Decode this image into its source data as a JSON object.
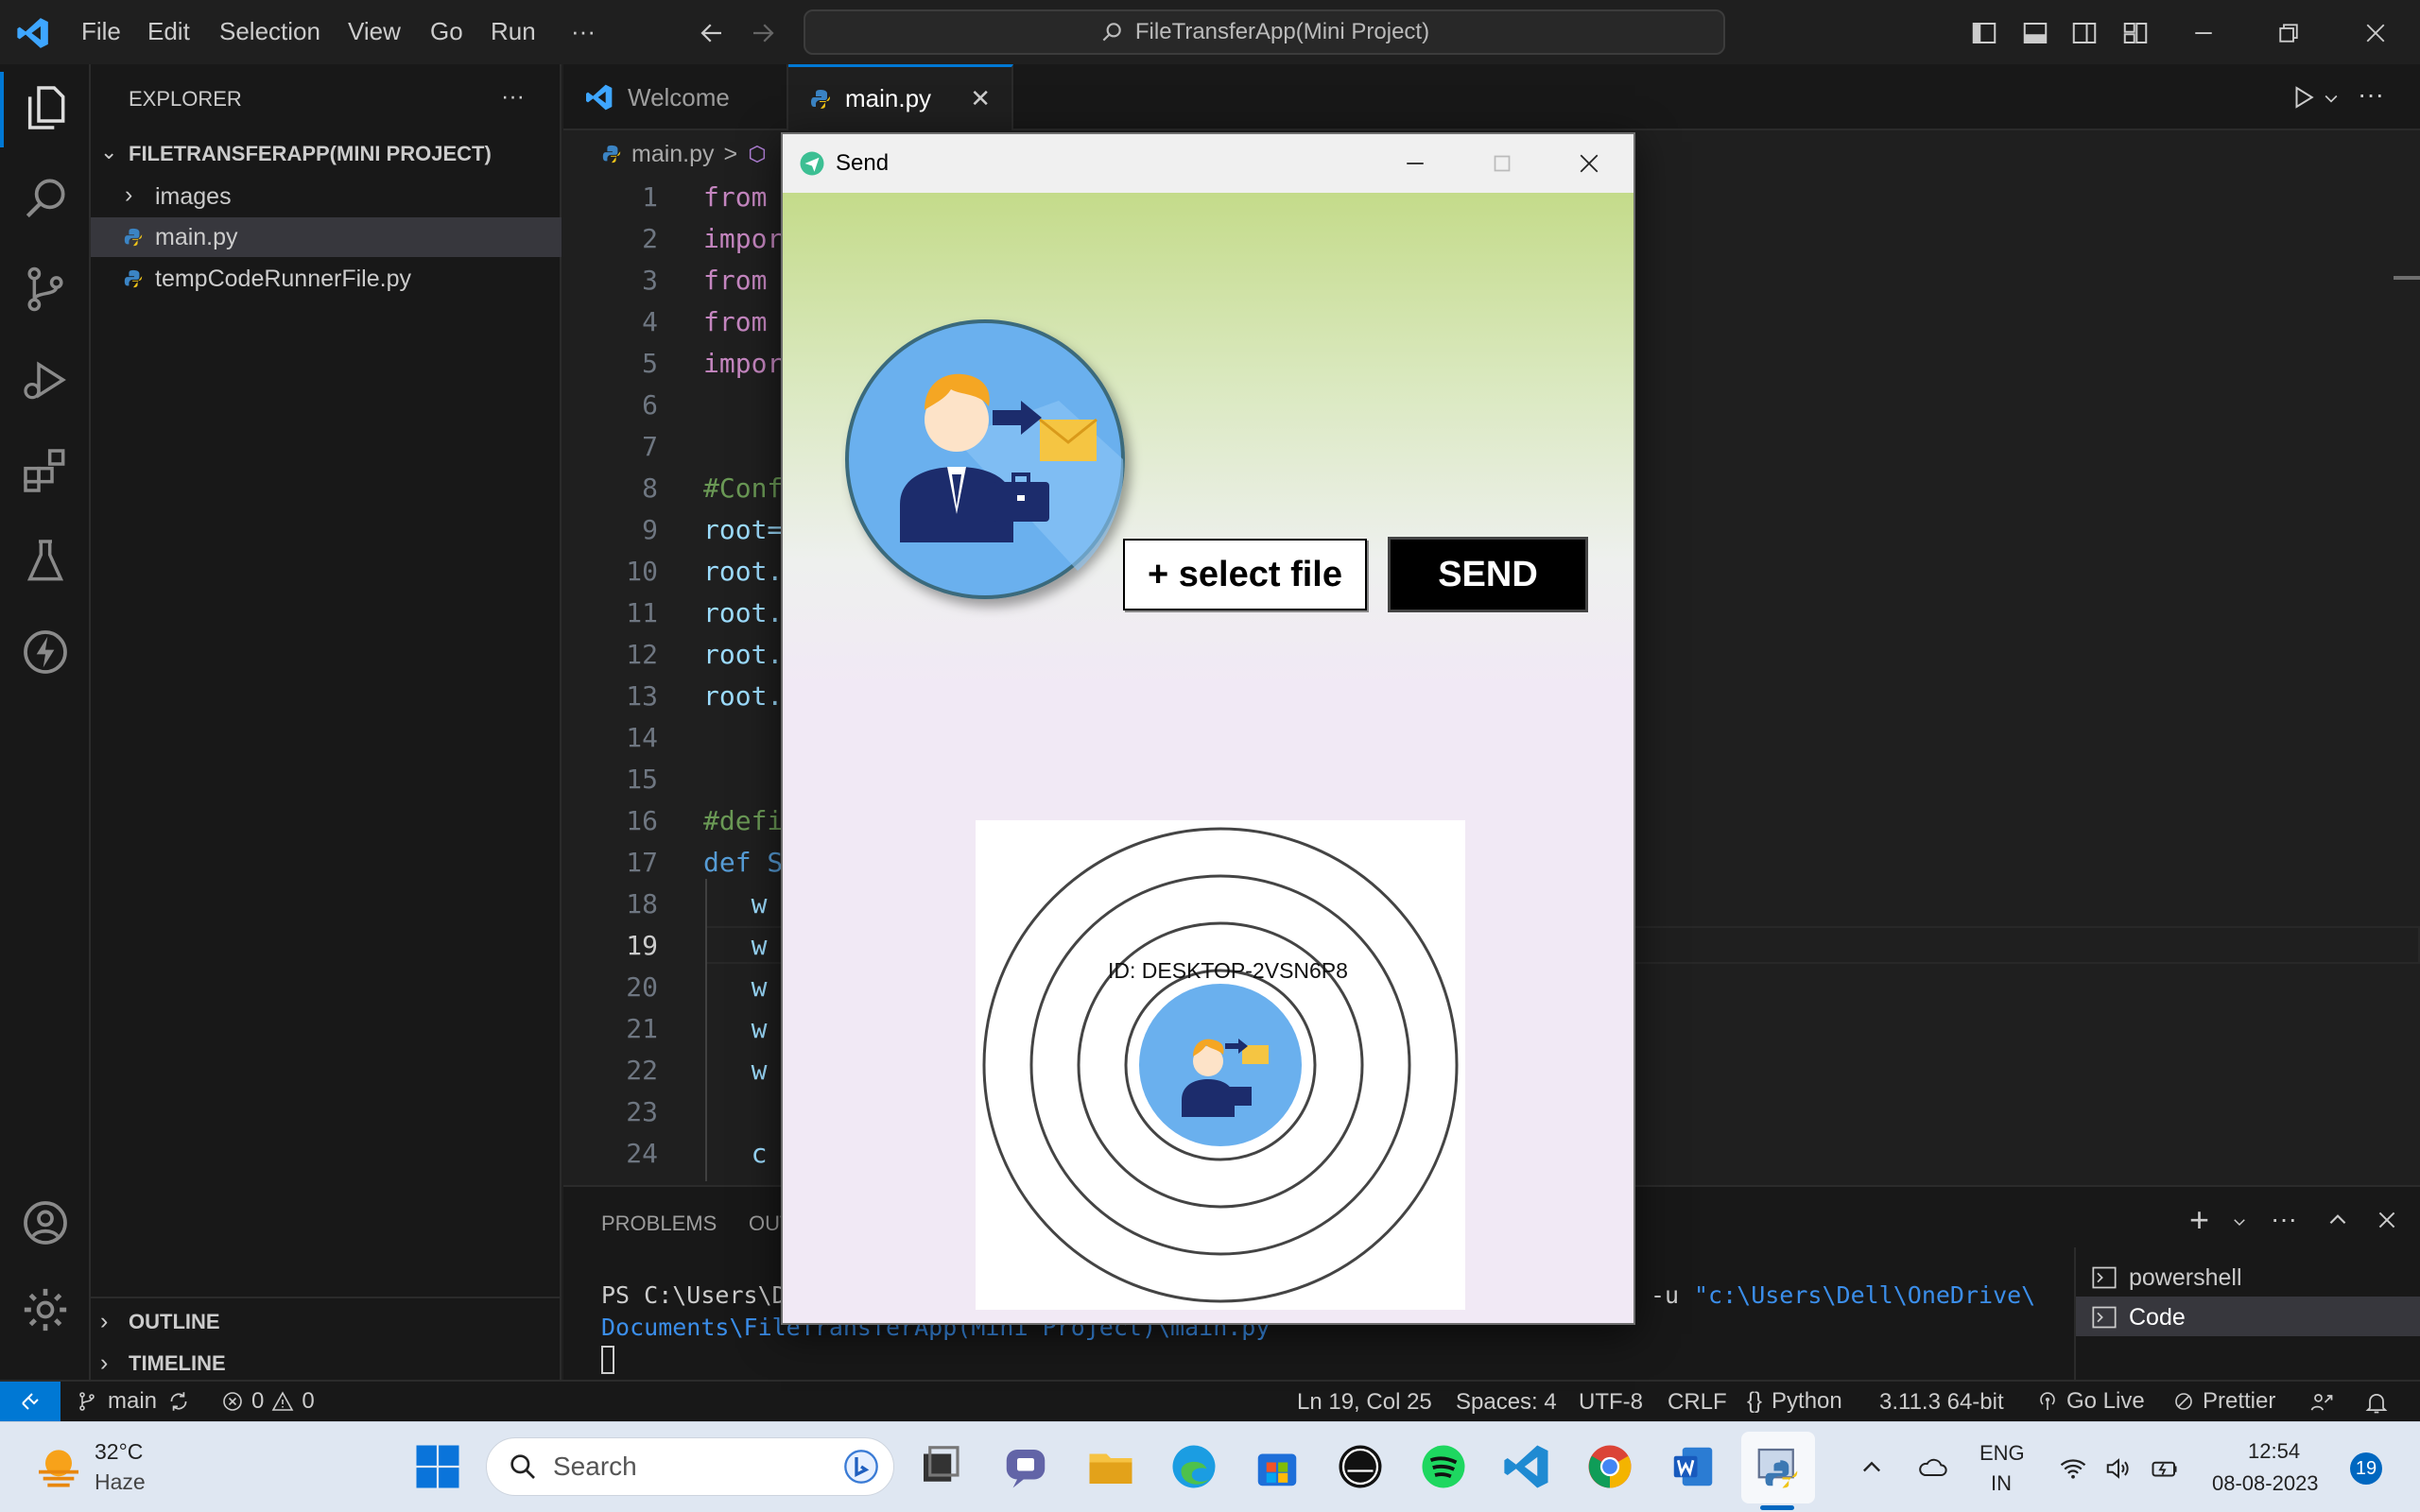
{
  "titlebar": {
    "menu": [
      "File",
      "Edit",
      "Selection",
      "View",
      "Go",
      "Run",
      "···"
    ],
    "search": "FileTransferApp(Mini Project)"
  },
  "sidebar": {
    "title": "EXPLORER",
    "more": "···",
    "project": "FILETRANSFERAPP(MINI PROJECT)",
    "items": [
      "images",
      "main.py",
      "tempCodeRunnerFile.py"
    ],
    "outline": "OUTLINE",
    "timeline": "TIMELINE"
  },
  "tabs": [
    {
      "label": "Welcome"
    },
    {
      "label": "main.py",
      "close": "✕"
    }
  ],
  "breadcrumb": {
    "file": "main.py",
    "sep": ">"
  },
  "code": {
    "line_numbers": [
      "1",
      "2",
      "3",
      "4",
      "5",
      "6",
      "7",
      "8",
      "9",
      "10",
      "11",
      "12",
      "13",
      "14",
      "15",
      "16",
      "17",
      "18",
      "19",
      "20",
      "21",
      "22",
      "23",
      "24"
    ],
    "lines": [
      {
        "text": "from",
        "color": "#c586c0"
      },
      {
        "text": "impor",
        "color": "#c586c0"
      },
      {
        "text": "from",
        "color": "#c586c0"
      },
      {
        "text": "from",
        "color": "#c586c0"
      },
      {
        "text": "impor",
        "color": "#c586c0"
      },
      {
        "text": "",
        "color": "#ccc"
      },
      {
        "text": "",
        "color": "#ccc"
      },
      {
        "text": "#Conf",
        "color": "#6a9955"
      },
      {
        "text": "root=",
        "color": "#9cdcfe"
      },
      {
        "text": "root.",
        "color": "#9cdcfe"
      },
      {
        "text": "root.",
        "color": "#9cdcfe"
      },
      {
        "text": "root.",
        "color": "#9cdcfe"
      },
      {
        "text": "root.",
        "color": "#9cdcfe"
      },
      {
        "text": "",
        "color": "#ccc"
      },
      {
        "text": "",
        "color": "#ccc"
      },
      {
        "text": "#defi",
        "color": "#6a9955"
      },
      {
        "text": "def S",
        "color": "#569cd6"
      },
      {
        "text": "   w",
        "color": "#9cdcfe"
      },
      {
        "text": "   w",
        "color": "#9cdcfe"
      },
      {
        "text": "   w",
        "color": "#9cdcfe"
      },
      {
        "text": "   w",
        "color": "#9cdcfe"
      },
      {
        "text": "   w",
        "color": "#9cdcfe"
      },
      {
        "text": "",
        "color": "#ccc"
      },
      {
        "text": "   c",
        "color": "#9cdcfe"
      }
    ]
  },
  "panel": {
    "tabs": [
      "PROBLEMS",
      "OUT"
    ],
    "terminal_line1_a": "PS C:\\Users\\D",
    "terminal_line1_b": "-u ",
    "terminal_line1_c": "\"c:\\Users\\Dell\\OneDrive\\",
    "terminal_line2": "Documents\\FileTransferApp(Mini Project)\\main.py",
    "terminals": [
      "powershell",
      "Code"
    ]
  },
  "statusbar": {
    "branch": "main",
    "errors": "0",
    "warnings": "0",
    "position": "Ln 19, Col 25",
    "spaces": "Spaces: 4",
    "encoding": "UTF-8",
    "eol": "CRLF",
    "language": "Python",
    "interpreter": "3.11.3 64-bit",
    "golive": "Go Live",
    "prettier": "Prettier"
  },
  "send_window": {
    "title": "Send",
    "select_label": "+ select file",
    "send_label": "SEND",
    "id_label": "ID: DESKTOP-2VSN6P8"
  },
  "taskbar": {
    "temp": "32°C",
    "weather": "Haze",
    "search": "Search",
    "lang1": "ENG",
    "lang2": "IN",
    "time": "12:54",
    "date": "08-08-2023",
    "notif": "19"
  },
  "colors": {
    "accent": "#0078d4",
    "send_button_bg": "#000000",
    "select_button_bg": "#ffffff"
  }
}
